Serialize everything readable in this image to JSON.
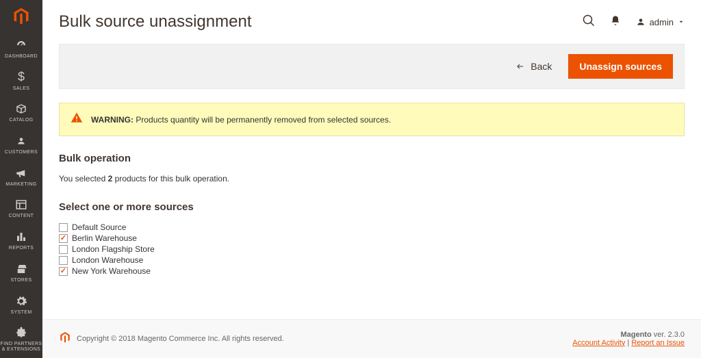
{
  "sidenav": {
    "items": [
      {
        "label": "DASHBOARD"
      },
      {
        "label": "SALES"
      },
      {
        "label": "CATALOG"
      },
      {
        "label": "CUSTOMERS"
      },
      {
        "label": "MARKETING"
      },
      {
        "label": "CONTENT"
      },
      {
        "label": "REPORTS"
      },
      {
        "label": "STORES"
      },
      {
        "label": "SYSTEM"
      },
      {
        "label": "FIND PARTNERS\n& EXTENSIONS"
      }
    ]
  },
  "header": {
    "title": "Bulk source unassignment",
    "user": "admin"
  },
  "toolbar": {
    "back": "Back",
    "primary": "Unassign sources"
  },
  "warning": {
    "label": "WARNING:",
    "text": "Products quantity will be permanently removed from selected sources."
  },
  "bulk": {
    "heading": "Bulk operation",
    "selected_prefix": "You selected ",
    "selected_count": "2",
    "selected_suffix": " products for this bulk operation."
  },
  "sources": {
    "heading": "Select one or more sources",
    "items": [
      {
        "label": "Default Source",
        "checked": false
      },
      {
        "label": "Berlin Warehouse",
        "checked": true
      },
      {
        "label": "London Flagship Store",
        "checked": false
      },
      {
        "label": "London Warehouse",
        "checked": false
      },
      {
        "label": "New York Warehouse",
        "checked": true
      }
    ]
  },
  "footer": {
    "copyright": "Copyright © 2018 Magento Commerce Inc. All rights reserved.",
    "product": "Magento",
    "ver_label": " ver. ",
    "version": "2.3.0",
    "account_activity": "Account Activity",
    "separator": " | ",
    "report": "Report an Issue"
  }
}
